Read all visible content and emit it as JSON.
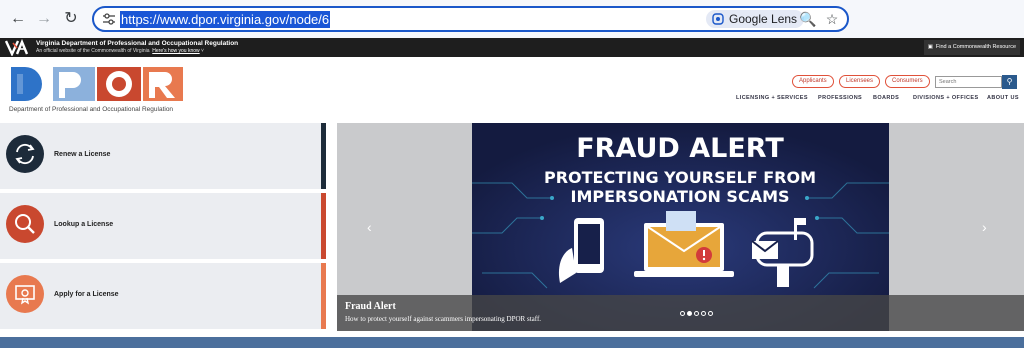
{
  "browser": {
    "url": "https://www.dpor.virginia.gov/node/6",
    "lens_label": "Google Lens"
  },
  "gov_bar": {
    "title": "Virginia Department of Professional and Occupational Regulation",
    "official_text": "An official website of the Commonwealth of Virginia",
    "how_you_know": "Here's how you know",
    "resource_label": "Find a Commonwealth Resource"
  },
  "header": {
    "logo_caption": "Department of Professional and Occupational Regulation",
    "pills": [
      "Applicants",
      "Licensees",
      "Consumers"
    ],
    "search_placeholder": "Search",
    "nav": [
      "LICENSING + SERVICES",
      "PROFESSIONS",
      "BOARDS",
      "DIVISIONS + OFFICES",
      "ABOUT US"
    ]
  },
  "quick_links": [
    {
      "label": "Renew a License",
      "color": "#1d2b3a"
    },
    {
      "label": "Lookup a License",
      "color": "#c9482f"
    },
    {
      "label": "Apply for a License",
      "color": "#e8794f"
    }
  ],
  "carousel": {
    "banner_heading": "FRAUD ALERT",
    "banner_sub_1": "PROTECTING YOURSELF FROM",
    "banner_sub_2": "IMPERSONATION SCAMS",
    "caption_title": "Fraud Alert",
    "caption_text": "How to protect yourself against scammers impersonating DPOR staff.",
    "slide_count": 5,
    "active_slide": 2
  },
  "colors": {
    "brand_blue": "#2b5a8d",
    "accent_red": "#e0513a"
  }
}
